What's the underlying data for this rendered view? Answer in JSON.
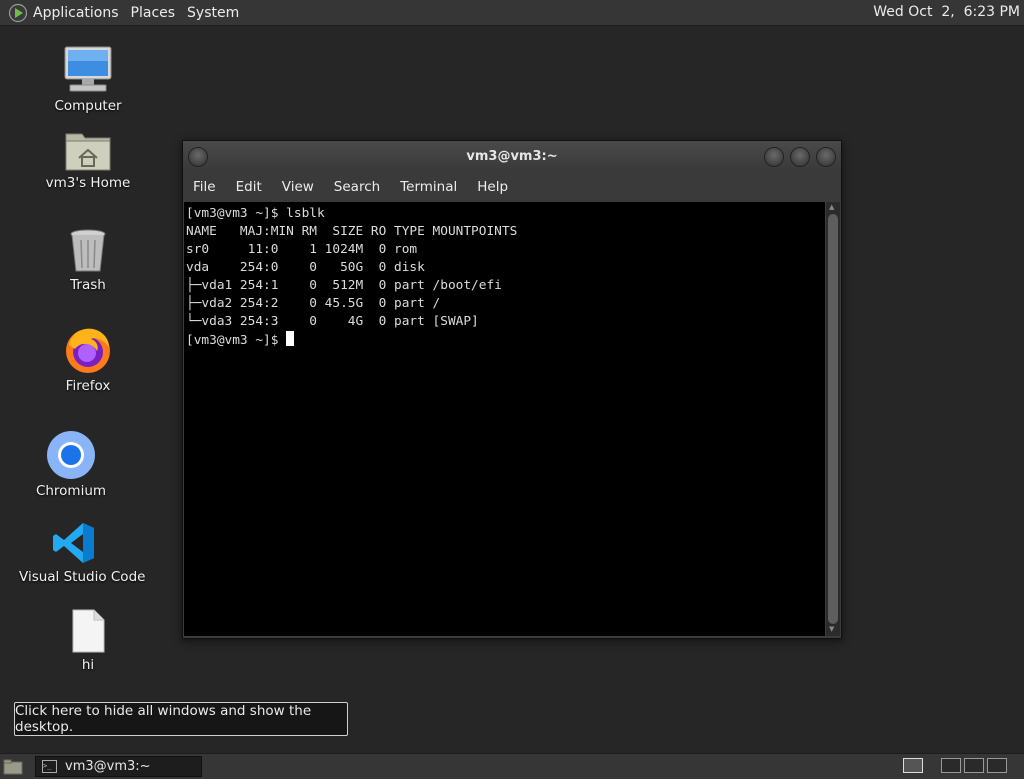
{
  "top_panel": {
    "menus": [
      "Applications",
      "Places",
      "System"
    ],
    "clock": "Wed Oct  2,  6:23 PM"
  },
  "desktop_icons": [
    {
      "label": "Computer",
      "icon": "computer-icon"
    },
    {
      "label": "vm3's Home",
      "icon": "home-folder-icon"
    },
    {
      "label": "Trash",
      "icon": "trash-icon"
    },
    {
      "label": "Firefox",
      "icon": "firefox-icon"
    },
    {
      "label": "Chromium",
      "icon": "chromium-icon"
    },
    {
      "label": "Visual Studio Code",
      "icon": "vscode-icon"
    },
    {
      "label": "hi",
      "icon": "file-icon"
    }
  ],
  "terminal": {
    "title": "vm3@vm3:~",
    "menu": [
      "File",
      "Edit",
      "View",
      "Search",
      "Terminal",
      "Help"
    ],
    "lines": [
      "[vm3@vm3 ~]$ lsblk",
      "NAME   MAJ:MIN RM  SIZE RO TYPE MOUNTPOINTS",
      "sr0     11:0    1 1024M  0 rom",
      "vda    254:0    0   50G  0 disk",
      "├─vda1 254:1    0  512M  0 part /boot/efi",
      "├─vda2 254:2    0 45.5G  0 part /",
      "└─vda3 254:3    0    4G  0 part [SWAP]"
    ],
    "prompt": "[vm3@vm3 ~]$ "
  },
  "tooltip": "Click here to hide all windows and show the desktop.",
  "taskbar": {
    "task_label": "vm3@vm3:~"
  },
  "colors": {
    "desktop_bg": "#262626",
    "panel_bg": "#363636",
    "terminal_bg": "#000000",
    "terminal_fg": "#dcdcdc"
  }
}
